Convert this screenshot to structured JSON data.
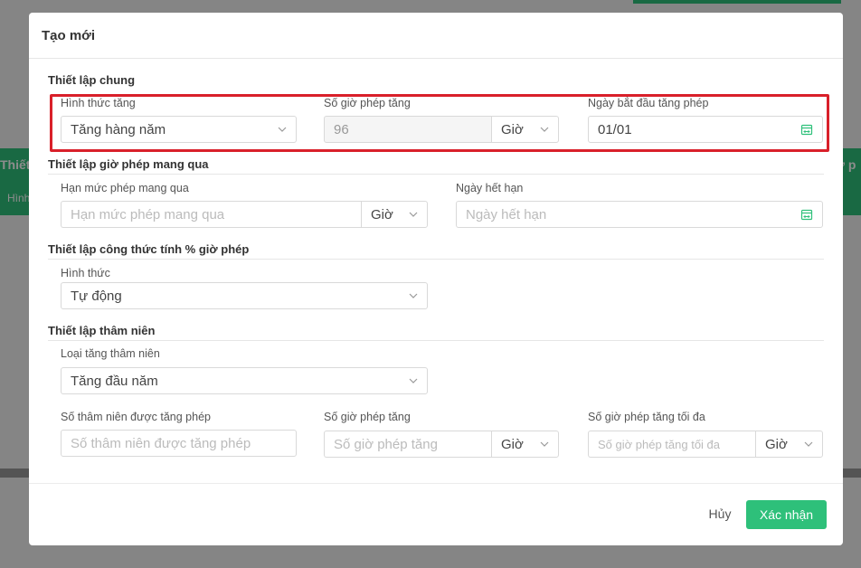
{
  "background": {
    "left_tab_title": "Thiết lập",
    "left_tab_sub": "Hình",
    "right_tab_title": "ơ p"
  },
  "modal": {
    "title": "Tạo mới",
    "general": {
      "title": "Thiết lập chung",
      "increase_type_label": "Hình thức tăng",
      "increase_type_value": "Tăng hàng năm",
      "hours_label": "Số giờ phép tăng",
      "hours_value": "96",
      "hours_unit": "Giờ",
      "start_date_label": "Ngày bắt đầu tăng phép",
      "start_date_value": "01/01"
    },
    "carry_over": {
      "title": "Thiết lập giờ phép mang qua",
      "limit_label": "Hạn mức phép mang qua",
      "limit_placeholder": "Hạn mức phép mang qua",
      "limit_unit": "Giờ",
      "expiry_label": "Ngày hết hạn",
      "expiry_placeholder": "Ngày hết hạn"
    },
    "formula": {
      "title": "Thiết lập công thức tính % giờ phép",
      "type_label": "Hình thức",
      "type_value": "Tự động"
    },
    "seniority": {
      "title": "Thiết lập thâm niên",
      "type_label": "Loại tăng thâm niên",
      "type_value": "Tăng đầu năm",
      "years_label": "Số thâm niên được tăng phép",
      "years_placeholder": "Số thâm niên được tăng phép",
      "hours_label": "Số giờ phép tăng",
      "hours_placeholder": "Số giờ phép tăng",
      "hours_unit": "Giờ",
      "max_label": "Số giờ phép tăng tối đa",
      "max_placeholder": "Số giờ phép tăng tối đa",
      "max_unit": "Giờ"
    },
    "footer": {
      "cancel_label": "Hủy",
      "confirm_label": "Xác nhận"
    }
  },
  "colors": {
    "accent": "#2ec07a",
    "highlight": "#d9202a"
  }
}
